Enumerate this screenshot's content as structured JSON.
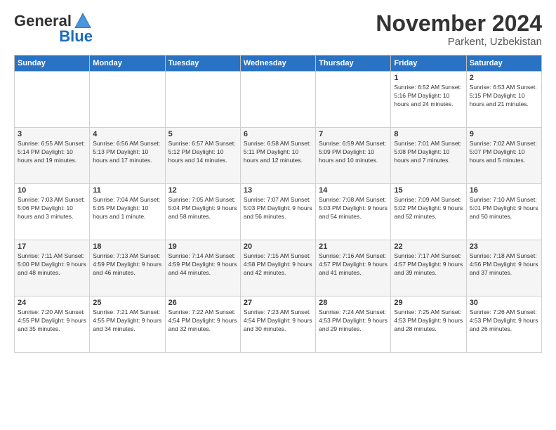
{
  "logo": {
    "general": "General",
    "blue": "Blue"
  },
  "header": {
    "month": "November 2024",
    "location": "Parkent, Uzbekistan"
  },
  "weekdays": [
    "Sunday",
    "Monday",
    "Tuesday",
    "Wednesday",
    "Thursday",
    "Friday",
    "Saturday"
  ],
  "weeks": [
    [
      {
        "day": "",
        "info": ""
      },
      {
        "day": "",
        "info": ""
      },
      {
        "day": "",
        "info": ""
      },
      {
        "day": "",
        "info": ""
      },
      {
        "day": "",
        "info": ""
      },
      {
        "day": "1",
        "info": "Sunrise: 6:52 AM\nSunset: 5:16 PM\nDaylight: 10 hours and 24 minutes."
      },
      {
        "day": "2",
        "info": "Sunrise: 6:53 AM\nSunset: 5:15 PM\nDaylight: 10 hours and 21 minutes."
      }
    ],
    [
      {
        "day": "3",
        "info": "Sunrise: 6:55 AM\nSunset: 5:14 PM\nDaylight: 10 hours and 19 minutes."
      },
      {
        "day": "4",
        "info": "Sunrise: 6:56 AM\nSunset: 5:13 PM\nDaylight: 10 hours and 17 minutes."
      },
      {
        "day": "5",
        "info": "Sunrise: 6:57 AM\nSunset: 5:12 PM\nDaylight: 10 hours and 14 minutes."
      },
      {
        "day": "6",
        "info": "Sunrise: 6:58 AM\nSunset: 5:11 PM\nDaylight: 10 hours and 12 minutes."
      },
      {
        "day": "7",
        "info": "Sunrise: 6:59 AM\nSunset: 5:09 PM\nDaylight: 10 hours and 10 minutes."
      },
      {
        "day": "8",
        "info": "Sunrise: 7:01 AM\nSunset: 5:08 PM\nDaylight: 10 hours and 7 minutes."
      },
      {
        "day": "9",
        "info": "Sunrise: 7:02 AM\nSunset: 5:07 PM\nDaylight: 10 hours and 5 minutes."
      }
    ],
    [
      {
        "day": "10",
        "info": "Sunrise: 7:03 AM\nSunset: 5:06 PM\nDaylight: 10 hours and 3 minutes."
      },
      {
        "day": "11",
        "info": "Sunrise: 7:04 AM\nSunset: 5:05 PM\nDaylight: 10 hours and 1 minute."
      },
      {
        "day": "12",
        "info": "Sunrise: 7:05 AM\nSunset: 5:04 PM\nDaylight: 9 hours and 58 minutes."
      },
      {
        "day": "13",
        "info": "Sunrise: 7:07 AM\nSunset: 5:03 PM\nDaylight: 9 hours and 56 minutes."
      },
      {
        "day": "14",
        "info": "Sunrise: 7:08 AM\nSunset: 5:03 PM\nDaylight: 9 hours and 54 minutes."
      },
      {
        "day": "15",
        "info": "Sunrise: 7:09 AM\nSunset: 5:02 PM\nDaylight: 9 hours and 52 minutes."
      },
      {
        "day": "16",
        "info": "Sunrise: 7:10 AM\nSunset: 5:01 PM\nDaylight: 9 hours and 50 minutes."
      }
    ],
    [
      {
        "day": "17",
        "info": "Sunrise: 7:11 AM\nSunset: 5:00 PM\nDaylight: 9 hours and 48 minutes."
      },
      {
        "day": "18",
        "info": "Sunrise: 7:13 AM\nSunset: 4:59 PM\nDaylight: 9 hours and 46 minutes."
      },
      {
        "day": "19",
        "info": "Sunrise: 7:14 AM\nSunset: 4:59 PM\nDaylight: 9 hours and 44 minutes."
      },
      {
        "day": "20",
        "info": "Sunrise: 7:15 AM\nSunset: 4:58 PM\nDaylight: 9 hours and 42 minutes."
      },
      {
        "day": "21",
        "info": "Sunrise: 7:16 AM\nSunset: 4:57 PM\nDaylight: 9 hours and 41 minutes."
      },
      {
        "day": "22",
        "info": "Sunrise: 7:17 AM\nSunset: 4:57 PM\nDaylight: 9 hours and 39 minutes."
      },
      {
        "day": "23",
        "info": "Sunrise: 7:18 AM\nSunset: 4:56 PM\nDaylight: 9 hours and 37 minutes."
      }
    ],
    [
      {
        "day": "24",
        "info": "Sunrise: 7:20 AM\nSunset: 4:55 PM\nDaylight: 9 hours and 35 minutes."
      },
      {
        "day": "25",
        "info": "Sunrise: 7:21 AM\nSunset: 4:55 PM\nDaylight: 9 hours and 34 minutes."
      },
      {
        "day": "26",
        "info": "Sunrise: 7:22 AM\nSunset: 4:54 PM\nDaylight: 9 hours and 32 minutes."
      },
      {
        "day": "27",
        "info": "Sunrise: 7:23 AM\nSunset: 4:54 PM\nDaylight: 9 hours and 30 minutes."
      },
      {
        "day": "28",
        "info": "Sunrise: 7:24 AM\nSunset: 4:53 PM\nDaylight: 9 hours and 29 minutes."
      },
      {
        "day": "29",
        "info": "Sunrise: 7:25 AM\nSunset: 4:53 PM\nDaylight: 9 hours and 28 minutes."
      },
      {
        "day": "30",
        "info": "Sunrise: 7:26 AM\nSunset: 4:53 PM\nDaylight: 9 hours and 26 minutes."
      }
    ]
  ]
}
